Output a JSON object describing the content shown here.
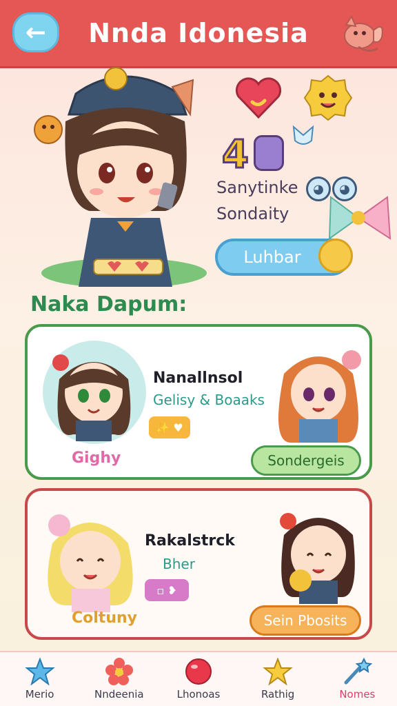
{
  "header": {
    "title": "Nnda Idonesia",
    "back_label": "back"
  },
  "hero": {
    "score": "4",
    "status_line1": "Sanytinke",
    "status_line2": "Sondaity",
    "action_button": "Luhbar"
  },
  "section": {
    "title": "Naka Dapum:"
  },
  "cards": [
    {
      "name": "Nanallnsol",
      "subtitle": "Gelisy & Boaaks",
      "tag_text": "✨ ♥",
      "label": "Gighy",
      "button": "Sondergeis"
    },
    {
      "name": "Rakalstrck",
      "subtitle": "Bher",
      "tag_text": "▫ ❥",
      "label": "Coltuny",
      "button": "Sein Pbosits"
    }
  ],
  "nav": [
    {
      "label": "Merio",
      "icon": "star-icon"
    },
    {
      "label": "Nndeenia",
      "icon": "flower-icon"
    },
    {
      "label": "Lhonoas",
      "icon": "ball-icon"
    },
    {
      "label": "Rathig",
      "icon": "star-gold-icon"
    },
    {
      "label": "Nomes",
      "icon": "wand-icon",
      "active": true
    }
  ],
  "colors": {
    "header": "#e55754",
    "accent_green": "#4a9a4c",
    "accent_red": "#c74a4a",
    "action_blue": "#7ecdf0"
  }
}
